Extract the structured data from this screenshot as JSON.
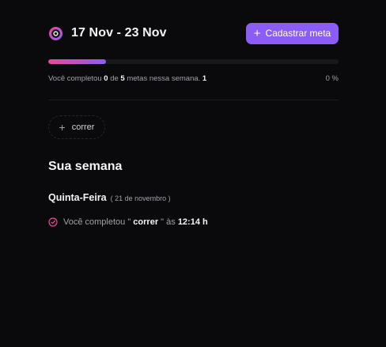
{
  "header": {
    "week_range": "17 Nov - 23 Nov",
    "create_goal_label": "Cadastrar meta",
    "logo_icon": "target-logo-icon"
  },
  "progress": {
    "completed": "0",
    "total": "5",
    "fraction": 0.2,
    "prefix": "Você completou",
    "of": "de",
    "suffix": "metas nessa semana.",
    "trailing_value": "1",
    "percent_label": "0 %"
  },
  "pending_goals": [
    {
      "label": "correr",
      "icon": "plus-icon"
    }
  ],
  "summary": {
    "title": "Sua semana",
    "days": [
      {
        "name": "Quinta-Feira",
        "date": "( 21 de novembro )",
        "entries": [
          {
            "prefix": "Você completou \"",
            "goal": "correr",
            "middle": "\" às",
            "time": "12:14 h",
            "icon": "check-circle-icon"
          }
        ]
      }
    ]
  },
  "colors": {
    "background": "#0a0a0c",
    "accent": "#8b5cf6",
    "accent_secondary": "#ec4899"
  }
}
